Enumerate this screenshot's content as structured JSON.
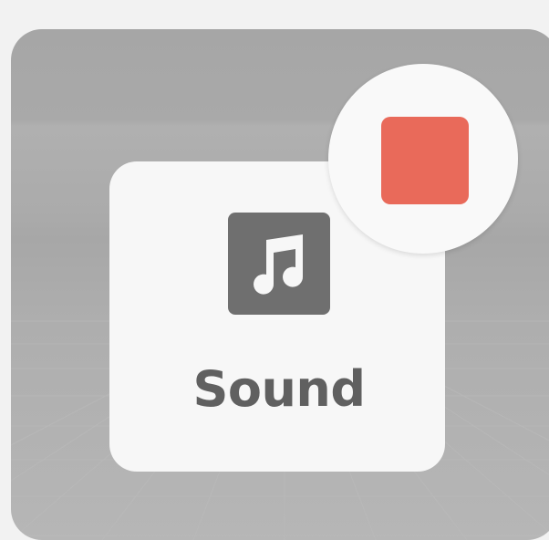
{
  "sound_card": {
    "label": "Sound",
    "icon": "music-note-icon"
  },
  "stop_button": {
    "icon": "stop-icon",
    "color": "#e96a5a"
  },
  "colors": {
    "card_background": "#f7f7f7",
    "icon_background": "#6f6f6f",
    "label_text": "#606060"
  }
}
